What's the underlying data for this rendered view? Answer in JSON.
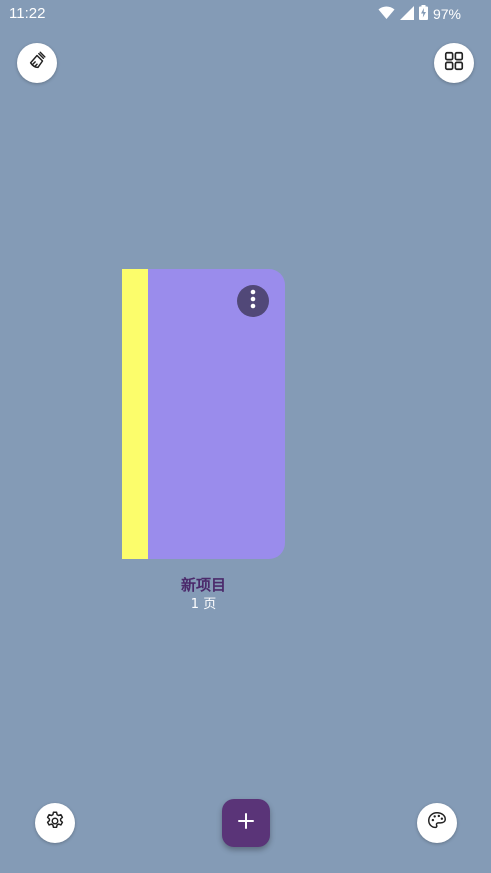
{
  "status_bar": {
    "time": "11:22",
    "battery": "97%",
    "icons": [
      "wifi-icon",
      "signal-icon",
      "battery-charging-icon"
    ]
  },
  "toolbar": {
    "left_icon": "cleanup-brush-icon",
    "right_icon": "grid-view-icon"
  },
  "notebook": {
    "title": "新项目",
    "pages": "1 页",
    "spine_color": "#fcfd6b",
    "cover_color": "#9a8cec",
    "menu_icon": "more-vert-icon"
  },
  "bottom_bar": {
    "left_icon": "settings-gear-icon",
    "fab_icon": "plus-icon",
    "right_icon": "palette-icon"
  },
  "colors": {
    "background": "#849bb6",
    "fab": "#5a3478",
    "title": "#4b2a6b"
  }
}
